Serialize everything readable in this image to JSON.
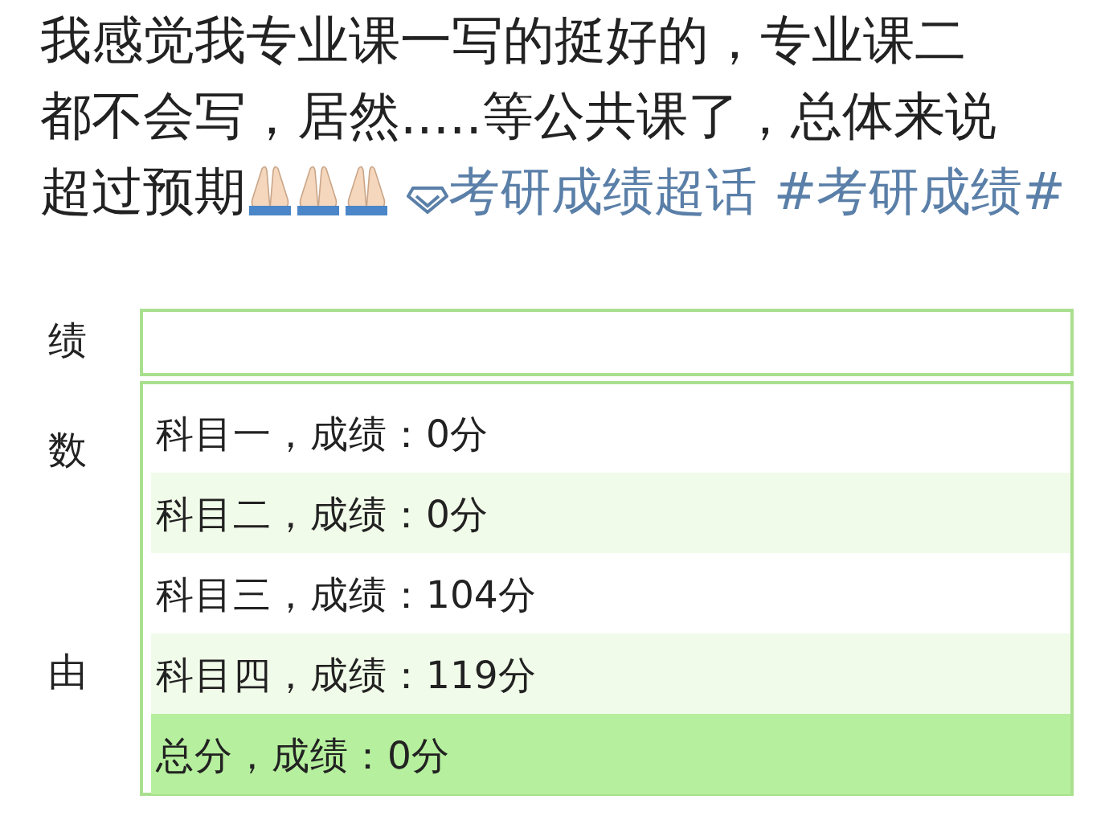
{
  "post": {
    "lines": [
      "我感觉我专业课一写的挺好的，专业课二",
      "都不会写，居然.....等公共课了，总体来说",
      "超过预期"
    ],
    "topic": "考研成绩超话",
    "hashtag": "#考研成绩#"
  },
  "form": {
    "labels": [
      "绩",
      "数",
      "由"
    ],
    "options": [
      {
        "text": "科目一，成绩：0分",
        "selected": false
      },
      {
        "text": "科目二，成绩：0分",
        "selected": false
      },
      {
        "text": "科目三，成绩：104分",
        "selected": false
      },
      {
        "text": "科目四，成绩：119分",
        "selected": false
      },
      {
        "text": "总分，成绩：0分",
        "selected": true
      }
    ]
  }
}
